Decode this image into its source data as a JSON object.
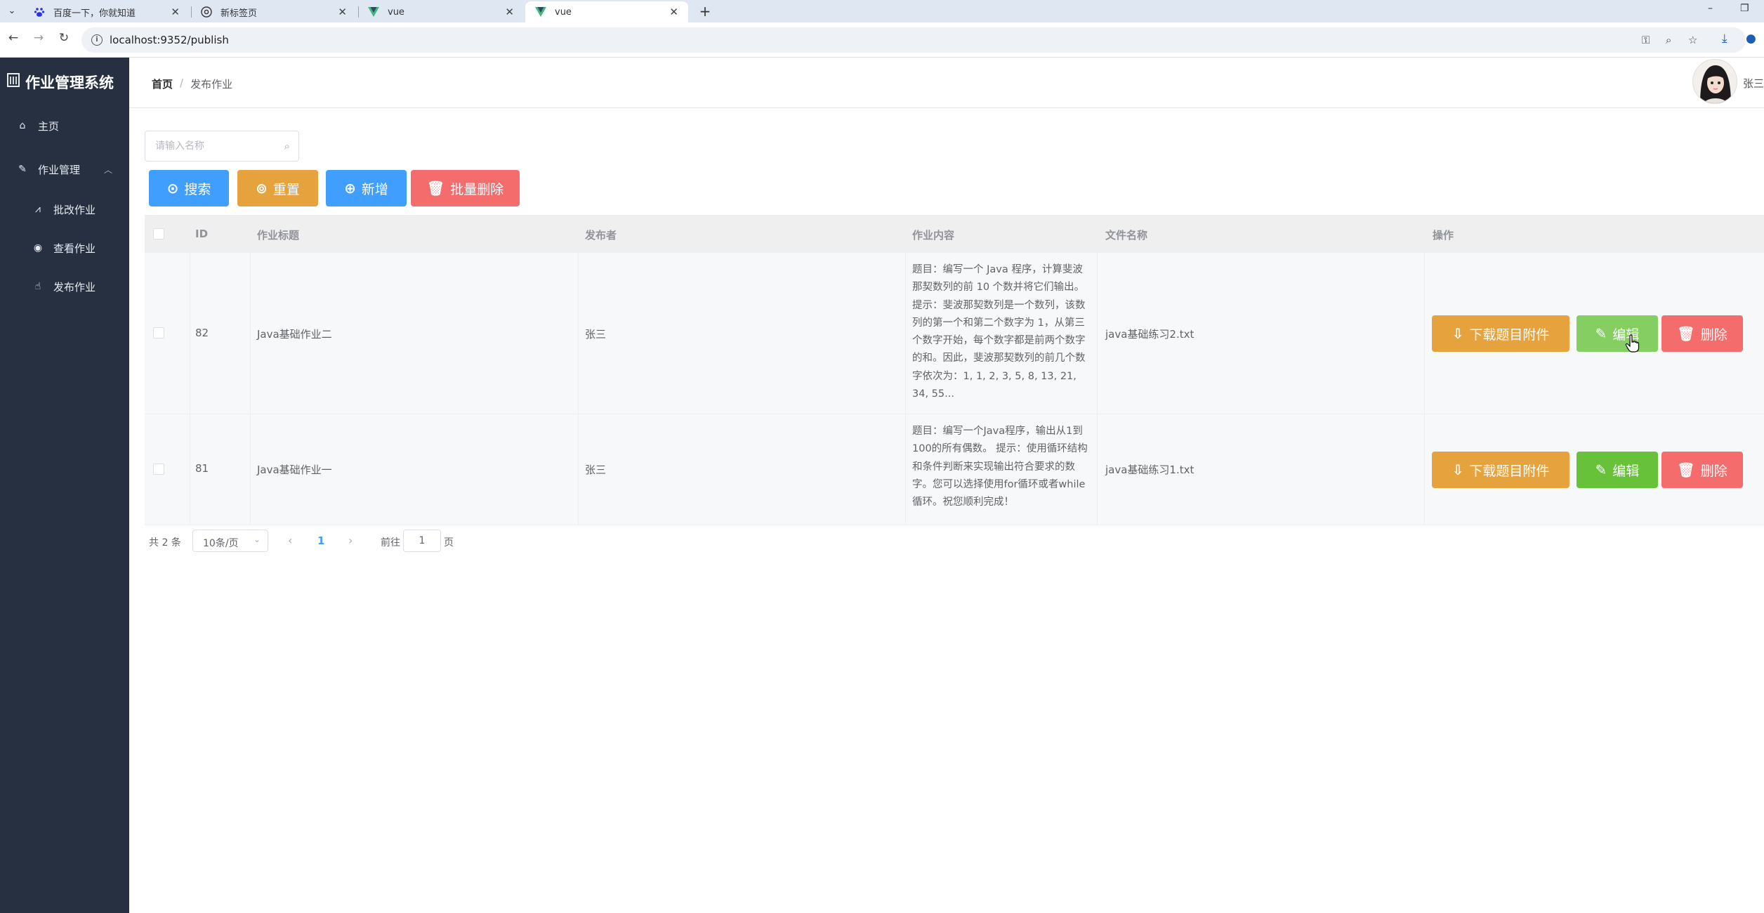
{
  "browser": {
    "tabs": [
      {
        "title": "百度一下，你就知道",
        "icon": "baidu-paw-icon"
      },
      {
        "title": "新标签页",
        "icon": "chrome-icon"
      },
      {
        "title": "vue",
        "icon": "vue-icon"
      },
      {
        "title": "vue",
        "icon": "vue-icon",
        "active": true
      }
    ],
    "url": "localhost:9352/publish"
  },
  "sidebar": {
    "logo_text": "作业管理系统",
    "items": [
      {
        "label": "主页",
        "icon": "home-icon"
      },
      {
        "label": "作业管理",
        "icon": "edit-icon",
        "expanded": true
      },
      {
        "label": "批改作业",
        "icon": "chart-icon"
      },
      {
        "label": "查看作业",
        "icon": "eye-icon"
      },
      {
        "label": "发布作业",
        "icon": "thumb-up-icon"
      }
    ],
    "colors": {
      "background": "#263041"
    }
  },
  "header": {
    "breadcrumb": {
      "home": "首页",
      "separator": "/",
      "current": "发布作业"
    },
    "username": "张三"
  },
  "search": {
    "placeholder": "请输入名称",
    "value": ""
  },
  "actions": {
    "search_label": "搜索",
    "reset_label": "重置",
    "add_label": "新增",
    "batch_delete_label": "批量删除"
  },
  "table": {
    "columns": [
      "ID",
      "作业标题",
      "发布者",
      "作业内容",
      "文件名称",
      "操作"
    ],
    "rows": [
      {
        "id": "82",
        "title": "Java基础作业二",
        "publisher": "张三",
        "content": "题目：编写一个 Java 程序，计算斐波那契数列的前 10 个数并将它们输出。 提示：斐波那契数列是一个数列，该数列的第一个和第二个数字为 1，从第三个数字开始，每个数字都是前两个数字的和。因此，斐波那契数列的前几个数字依次为：1, 1, 2, 3, 5, 8, 13, 21, 34, 55...",
        "file": "java基础练习2.txt"
      },
      {
        "id": "81",
        "title": "Java基础作业一",
        "publisher": "张三",
        "content": "题目：编写一个Java程序，输出从1到100的所有偶数。 提示：使用循环结构和条件判断来实现输出符合要求的数字。您可以选择使用for循环或者while循环。祝您顺利完成！",
        "file": "java基础练习1.txt"
      }
    ],
    "row_actions": {
      "download_label": "下载题目附件",
      "edit_label": "编辑",
      "delete_label": "删除"
    }
  },
  "pagination": {
    "total_text": "共 2 条",
    "page_size": "10条/页",
    "current_page": "1",
    "goto_prefix": "前往",
    "goto_value": "1",
    "goto_suffix": "页"
  },
  "colors": {
    "primary": "#409eff",
    "warning": "#e6a23c",
    "danger": "#f56c6c",
    "success": "#67c23a",
    "success_hover": "#85ce61"
  }
}
